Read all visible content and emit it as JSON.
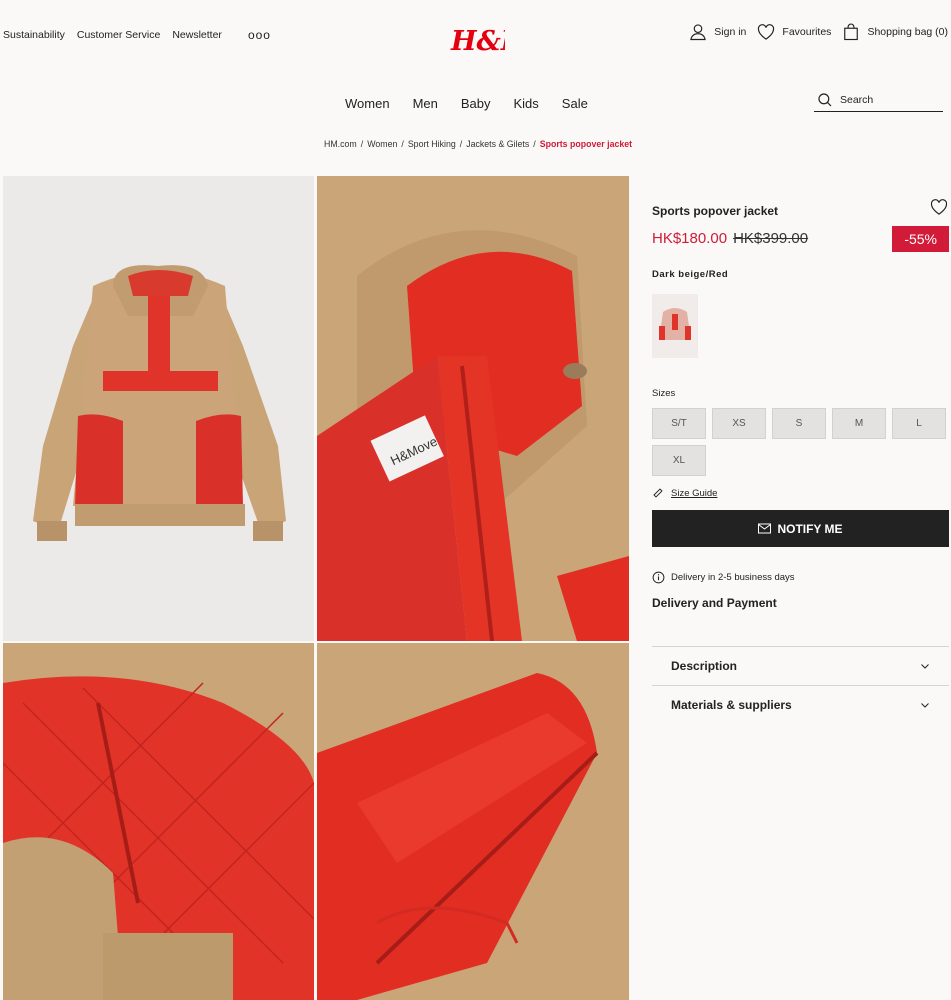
{
  "util_nav": {
    "links": [
      "Sustainability",
      "Customer Service",
      "Newsletter"
    ],
    "more": "ooo"
  },
  "logo": {
    "text": "H&M",
    "color": "#e50010"
  },
  "account": {
    "sign_in": "Sign in",
    "favourites": "Favourites",
    "bag": "Shopping bag (0)"
  },
  "main_nav": [
    "Women",
    "Men",
    "Baby",
    "Kids",
    "Sale"
  ],
  "search": {
    "placeholder": "Search"
  },
  "breadcrumb": {
    "items": [
      "HM.com",
      "Women",
      "Sport Hiking",
      "Jackets & Gilets"
    ],
    "current": "Sports popover jacket"
  },
  "gallery": {
    "label_on_jacket": "H&Move"
  },
  "product": {
    "title": "Sports popover jacket",
    "price": "HK$180.00",
    "old_price": "HK$399.00",
    "discount": "-55%",
    "color_name": "Dark beige/Red",
    "sizes_label": "Sizes",
    "sizes": [
      "S/T",
      "XS",
      "S",
      "M",
      "L",
      "XL"
    ],
    "size_guide": "Size Guide",
    "notify_button": "NOTIFY ME",
    "delivery_time": "Delivery in 2-5 business days",
    "delivery_heading": "Delivery and Payment",
    "accordions": [
      "Description",
      "Materials & suppliers"
    ]
  },
  "colors": {
    "accent_red": "#d11b38",
    "button_dark": "#222222",
    "fleece_beige": "#c9a577"
  }
}
